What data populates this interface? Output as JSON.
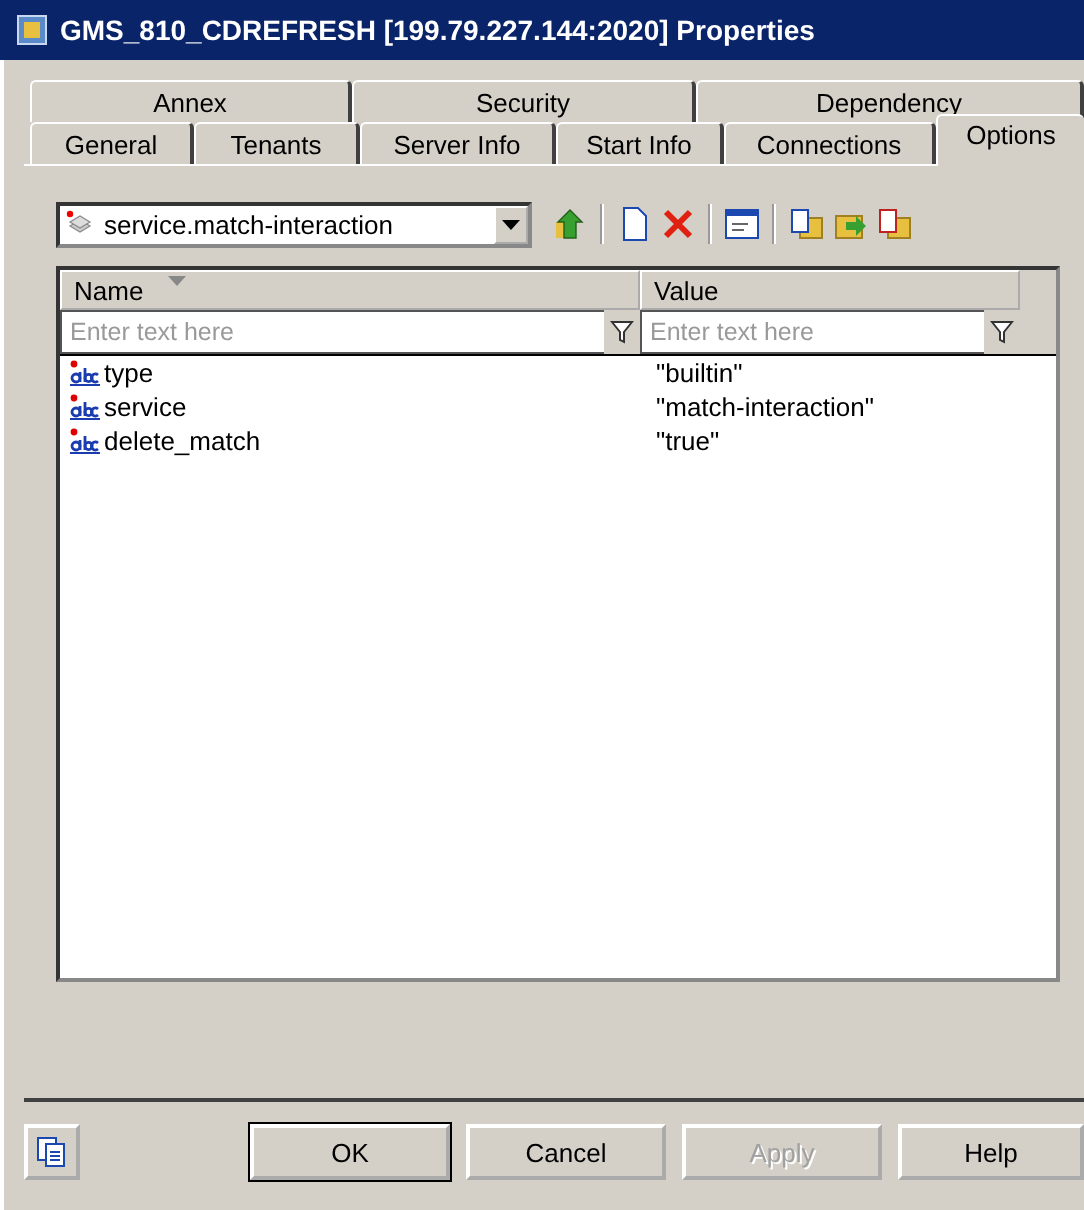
{
  "window": {
    "title": "GMS_810_CDREFRESH [199.79.227.144:2020] Properties"
  },
  "tab_rows": [
    [
      {
        "label": "Annex",
        "selected": false
      },
      {
        "label": "Security",
        "selected": false
      },
      {
        "label": "Dependency",
        "selected": false
      }
    ],
    [
      {
        "label": "General",
        "selected": false
      },
      {
        "label": "Tenants",
        "selected": false
      },
      {
        "label": "Server Info",
        "selected": false
      },
      {
        "label": "Start Info",
        "selected": false
      },
      {
        "label": "Connections",
        "selected": false
      },
      {
        "label": "Options",
        "selected": true
      }
    ]
  ],
  "section_dropdown": {
    "value": "service.match-interaction"
  },
  "table": {
    "columns": [
      {
        "label": "Name",
        "sorted": true,
        "placeholder": "Enter text here"
      },
      {
        "label": "Value",
        "sorted": false,
        "placeholder": "Enter text here"
      }
    ],
    "rows": [
      {
        "name": "type",
        "value": "\"builtin\""
      },
      {
        "name": "service",
        "value": "\"match-interaction\""
      },
      {
        "name": "delete_match",
        "value": "\"true\""
      }
    ]
  },
  "buttons": [
    {
      "label": "OK",
      "default": true,
      "disabled": false
    },
    {
      "label": "Cancel",
      "default": false,
      "disabled": false
    },
    {
      "label": "Apply",
      "default": false,
      "disabled": true
    },
    {
      "label": "Help",
      "default": false,
      "disabled": false
    }
  ]
}
